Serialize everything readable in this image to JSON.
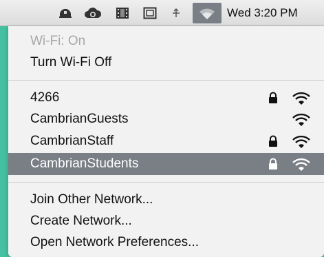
{
  "menubar": {
    "icons": [
      "helmet-icon",
      "cloud-sync-icon",
      "film-icon",
      "display-icon",
      "bluetooth-arrow-icon",
      "wifi-icon"
    ],
    "clock": "Wed 3:20 PM"
  },
  "wifi_menu": {
    "status": "Wi-Fi: On",
    "toggle": "Turn Wi-Fi Off",
    "networks": [
      {
        "name": "4266",
        "locked": true,
        "selected": false
      },
      {
        "name": "CambrianGuests",
        "locked": false,
        "selected": false
      },
      {
        "name": "CambrianStaff",
        "locked": true,
        "selected": false
      },
      {
        "name": "CambrianStudents",
        "locked": true,
        "selected": true
      }
    ],
    "join_other": "Join Other Network...",
    "create": "Create Network...",
    "preferences": "Open Network Preferences..."
  },
  "colors": {
    "desktop": "#4fc3a1",
    "selection": "#7a7e85",
    "menu_bg": "#f2f2f2"
  }
}
